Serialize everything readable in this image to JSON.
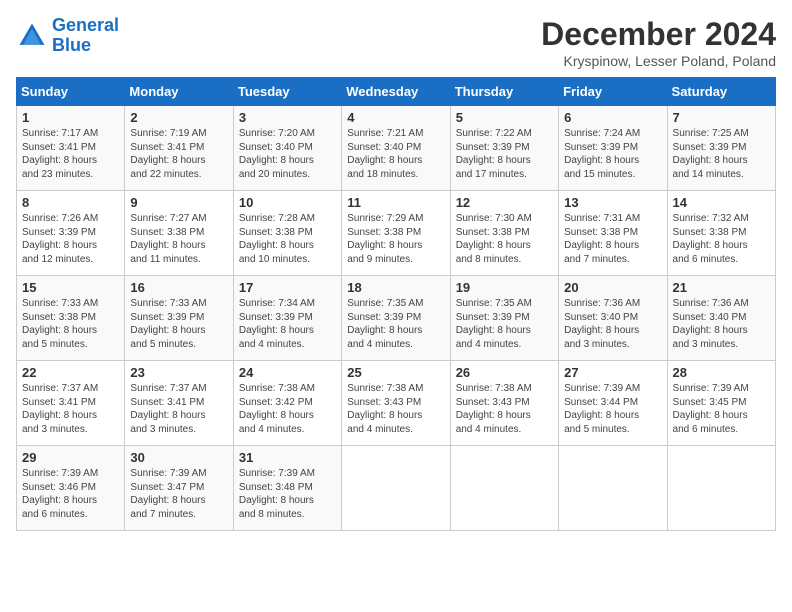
{
  "header": {
    "logo_line1": "General",
    "logo_line2": "Blue",
    "month": "December 2024",
    "location": "Kryspinow, Lesser Poland, Poland"
  },
  "weekdays": [
    "Sunday",
    "Monday",
    "Tuesday",
    "Wednesday",
    "Thursday",
    "Friday",
    "Saturday"
  ],
  "weeks": [
    [
      {
        "day": "1",
        "info": "Sunrise: 7:17 AM\nSunset: 3:41 PM\nDaylight: 8 hours\nand 23 minutes."
      },
      {
        "day": "2",
        "info": "Sunrise: 7:19 AM\nSunset: 3:41 PM\nDaylight: 8 hours\nand 22 minutes."
      },
      {
        "day": "3",
        "info": "Sunrise: 7:20 AM\nSunset: 3:40 PM\nDaylight: 8 hours\nand 20 minutes."
      },
      {
        "day": "4",
        "info": "Sunrise: 7:21 AM\nSunset: 3:40 PM\nDaylight: 8 hours\nand 18 minutes."
      },
      {
        "day": "5",
        "info": "Sunrise: 7:22 AM\nSunset: 3:39 PM\nDaylight: 8 hours\nand 17 minutes."
      },
      {
        "day": "6",
        "info": "Sunrise: 7:24 AM\nSunset: 3:39 PM\nDaylight: 8 hours\nand 15 minutes."
      },
      {
        "day": "7",
        "info": "Sunrise: 7:25 AM\nSunset: 3:39 PM\nDaylight: 8 hours\nand 14 minutes."
      }
    ],
    [
      {
        "day": "8",
        "info": "Sunrise: 7:26 AM\nSunset: 3:39 PM\nDaylight: 8 hours\nand 12 minutes."
      },
      {
        "day": "9",
        "info": "Sunrise: 7:27 AM\nSunset: 3:38 PM\nDaylight: 8 hours\nand 11 minutes."
      },
      {
        "day": "10",
        "info": "Sunrise: 7:28 AM\nSunset: 3:38 PM\nDaylight: 8 hours\nand 10 minutes."
      },
      {
        "day": "11",
        "info": "Sunrise: 7:29 AM\nSunset: 3:38 PM\nDaylight: 8 hours\nand 9 minutes."
      },
      {
        "day": "12",
        "info": "Sunrise: 7:30 AM\nSunset: 3:38 PM\nDaylight: 8 hours\nand 8 minutes."
      },
      {
        "day": "13",
        "info": "Sunrise: 7:31 AM\nSunset: 3:38 PM\nDaylight: 8 hours\nand 7 minutes."
      },
      {
        "day": "14",
        "info": "Sunrise: 7:32 AM\nSunset: 3:38 PM\nDaylight: 8 hours\nand 6 minutes."
      }
    ],
    [
      {
        "day": "15",
        "info": "Sunrise: 7:33 AM\nSunset: 3:38 PM\nDaylight: 8 hours\nand 5 minutes."
      },
      {
        "day": "16",
        "info": "Sunrise: 7:33 AM\nSunset: 3:39 PM\nDaylight: 8 hours\nand 5 minutes."
      },
      {
        "day": "17",
        "info": "Sunrise: 7:34 AM\nSunset: 3:39 PM\nDaylight: 8 hours\nand 4 minutes."
      },
      {
        "day": "18",
        "info": "Sunrise: 7:35 AM\nSunset: 3:39 PM\nDaylight: 8 hours\nand 4 minutes."
      },
      {
        "day": "19",
        "info": "Sunrise: 7:35 AM\nSunset: 3:39 PM\nDaylight: 8 hours\nand 4 minutes."
      },
      {
        "day": "20",
        "info": "Sunrise: 7:36 AM\nSunset: 3:40 PM\nDaylight: 8 hours\nand 3 minutes."
      },
      {
        "day": "21",
        "info": "Sunrise: 7:36 AM\nSunset: 3:40 PM\nDaylight: 8 hours\nand 3 minutes."
      }
    ],
    [
      {
        "day": "22",
        "info": "Sunrise: 7:37 AM\nSunset: 3:41 PM\nDaylight: 8 hours\nand 3 minutes."
      },
      {
        "day": "23",
        "info": "Sunrise: 7:37 AM\nSunset: 3:41 PM\nDaylight: 8 hours\nand 3 minutes."
      },
      {
        "day": "24",
        "info": "Sunrise: 7:38 AM\nSunset: 3:42 PM\nDaylight: 8 hours\nand 4 minutes."
      },
      {
        "day": "25",
        "info": "Sunrise: 7:38 AM\nSunset: 3:43 PM\nDaylight: 8 hours\nand 4 minutes."
      },
      {
        "day": "26",
        "info": "Sunrise: 7:38 AM\nSunset: 3:43 PM\nDaylight: 8 hours\nand 4 minutes."
      },
      {
        "day": "27",
        "info": "Sunrise: 7:39 AM\nSunset: 3:44 PM\nDaylight: 8 hours\nand 5 minutes."
      },
      {
        "day": "28",
        "info": "Sunrise: 7:39 AM\nSunset: 3:45 PM\nDaylight: 8 hours\nand 6 minutes."
      }
    ],
    [
      {
        "day": "29",
        "info": "Sunrise: 7:39 AM\nSunset: 3:46 PM\nDaylight: 8 hours\nand 6 minutes."
      },
      {
        "day": "30",
        "info": "Sunrise: 7:39 AM\nSunset: 3:47 PM\nDaylight: 8 hours\nand 7 minutes."
      },
      {
        "day": "31",
        "info": "Sunrise: 7:39 AM\nSunset: 3:48 PM\nDaylight: 8 hours\nand 8 minutes."
      },
      null,
      null,
      null,
      null
    ]
  ]
}
